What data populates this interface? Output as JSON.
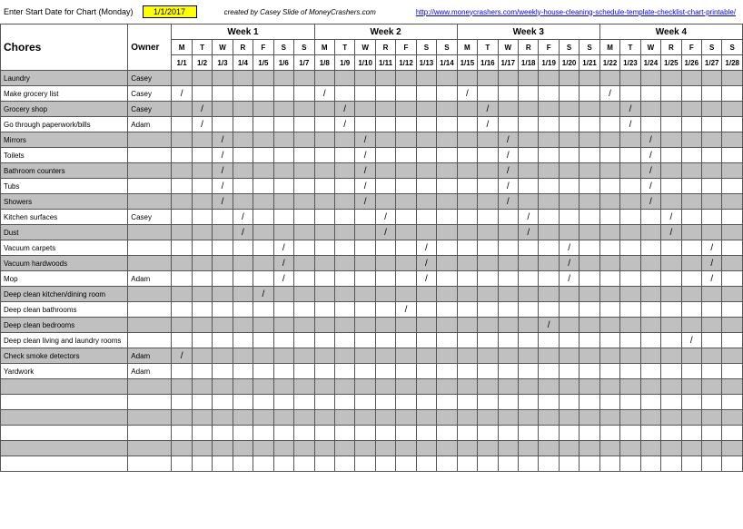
{
  "top": {
    "label": "Enter Start Date for Chart (Monday)",
    "start_date": "1/1/2017",
    "credit": "created by Casey Slide of MoneyCrashers.com",
    "link": "http://www.moneycrashers.com/weekly-house-cleaning-schedule-template-checklist-chart-printable/"
  },
  "headers": {
    "chores": "Chores",
    "owner": "Owner",
    "weeks": [
      "Week 1",
      "Week 2",
      "Week 3",
      "Week 4"
    ],
    "days": [
      "M",
      "T",
      "W",
      "R",
      "F",
      "S",
      "S"
    ],
    "dates": [
      "1/1",
      "1/2",
      "1/3",
      "1/4",
      "1/5",
      "1/6",
      "1/7",
      "1/8",
      "1/9",
      "1/10",
      "1/11",
      "1/12",
      "1/13",
      "1/14",
      "1/15",
      "1/16",
      "1/17",
      "1/18",
      "1/19",
      "1/20",
      "1/21",
      "1/22",
      "1/23",
      "1/24",
      "1/25",
      "1/26",
      "1/27",
      "1/28"
    ]
  },
  "rows": [
    {
      "chore": "Laundry",
      "owner": "Casey",
      "marks": []
    },
    {
      "chore": "Make grocery list",
      "owner": "Casey",
      "marks": [
        0,
        7,
        14,
        21
      ]
    },
    {
      "chore": "Grocery shop",
      "owner": "Casey",
      "marks": [
        1,
        8,
        15,
        22
      ]
    },
    {
      "chore": "Go through paperwork/bills",
      "owner": "Adam",
      "marks": [
        1,
        8,
        15,
        22
      ]
    },
    {
      "chore": "Mirrors",
      "owner": "",
      "marks": [
        2,
        9,
        16,
        23
      ]
    },
    {
      "chore": "Toilets",
      "owner": "",
      "marks": [
        2,
        9,
        16,
        23
      ]
    },
    {
      "chore": "Bathroom counters",
      "owner": "",
      "marks": [
        2,
        9,
        16,
        23
      ]
    },
    {
      "chore": "Tubs",
      "owner": "",
      "marks": [
        2,
        9,
        16,
        23
      ]
    },
    {
      "chore": "Showers",
      "owner": "",
      "marks": [
        2,
        9,
        16,
        23
      ]
    },
    {
      "chore": "Kitchen surfaces",
      "owner": "Casey",
      "marks": [
        3,
        10,
        17,
        24
      ]
    },
    {
      "chore": "Dust",
      "owner": "",
      "marks": [
        3,
        10,
        17,
        24
      ]
    },
    {
      "chore": "Vacuum carpets",
      "owner": "",
      "marks": [
        5,
        12,
        19,
        26
      ]
    },
    {
      "chore": "Vacuum hardwoods",
      "owner": "",
      "marks": [
        5,
        12,
        19,
        26
      ]
    },
    {
      "chore": "Mop",
      "owner": "Adam",
      "marks": [
        5,
        12,
        19,
        26
      ]
    },
    {
      "chore": "Deep clean kitchen/dining room",
      "owner": "",
      "marks": [
        4
      ]
    },
    {
      "chore": "Deep clean bathrooms",
      "owner": "",
      "marks": [
        11
      ]
    },
    {
      "chore": "Deep clean bedrooms",
      "owner": "",
      "marks": [
        18
      ]
    },
    {
      "chore": "Deep clean living and laundry rooms",
      "owner": "",
      "marks": [
        25
      ]
    },
    {
      "chore": "Check smoke detectors",
      "owner": "Adam",
      "marks": [
        0
      ]
    },
    {
      "chore": "Yardwork",
      "owner": "Adam",
      "marks": []
    },
    {
      "chore": "",
      "owner": "",
      "marks": []
    },
    {
      "chore": "",
      "owner": "",
      "marks": []
    },
    {
      "chore": "",
      "owner": "",
      "marks": []
    },
    {
      "chore": "",
      "owner": "",
      "marks": []
    },
    {
      "chore": "",
      "owner": "",
      "marks": []
    },
    {
      "chore": "",
      "owner": "",
      "marks": []
    }
  ]
}
